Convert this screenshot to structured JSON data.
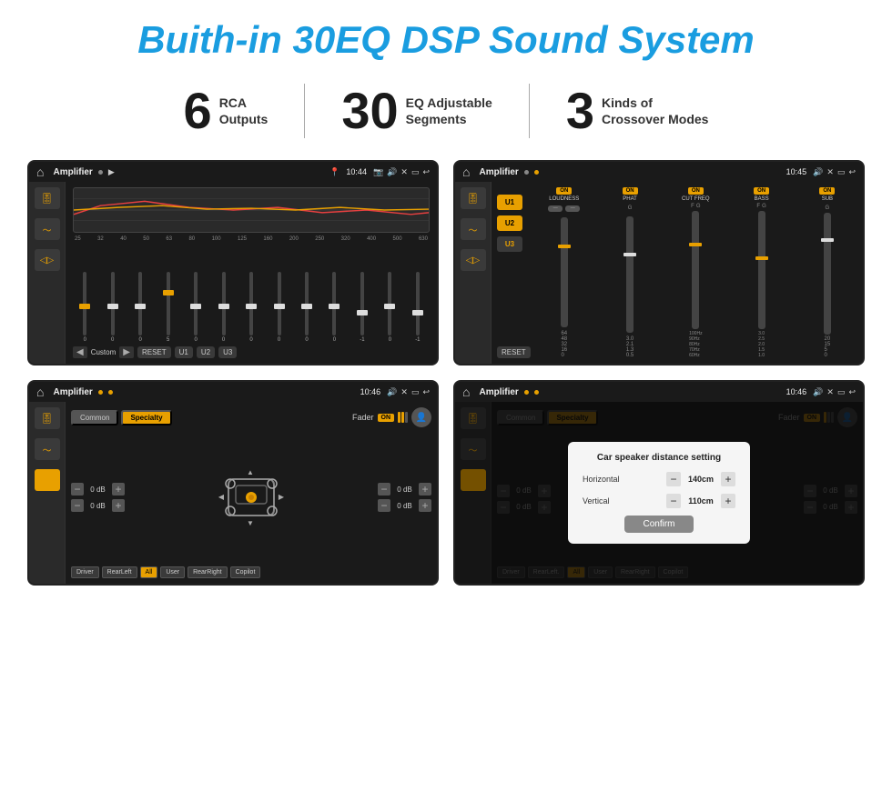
{
  "title": "Buith-in 30EQ DSP Sound System",
  "stats": [
    {
      "number": "6",
      "label": "RCA\nOutputs"
    },
    {
      "number": "30",
      "label": "EQ Adjustable\nSegments"
    },
    {
      "number": "3",
      "label": "Kinds of\nCrossover Modes"
    }
  ],
  "screens": [
    {
      "id": "eq-screen",
      "status_title": "Amplifier",
      "status_time": "10:44",
      "type": "equalizer",
      "freq_labels": [
        "25",
        "32",
        "40",
        "50",
        "63",
        "80",
        "100",
        "125",
        "160",
        "200",
        "250",
        "320",
        "400",
        "500",
        "630"
      ],
      "slider_values": [
        "0",
        "0",
        "0",
        "5",
        "0",
        "0",
        "0",
        "0",
        "0",
        "0",
        "-1",
        "0",
        "-1"
      ],
      "bottom_buttons": [
        "Custom",
        "RESET",
        "U1",
        "U2",
        "U3"
      ]
    },
    {
      "id": "crossover-screen",
      "status_title": "Amplifier",
      "status_time": "10:45",
      "type": "crossover",
      "presets": [
        "U1",
        "U2",
        "U3"
      ],
      "columns": [
        {
          "label": "LOUDNESS",
          "on": true
        },
        {
          "label": "PHAT",
          "on": true
        },
        {
          "label": "CUT FREQ",
          "on": true
        },
        {
          "label": "BASS",
          "on": true
        },
        {
          "label": "SUB",
          "on": true
        }
      ],
      "reset_btn": "RESET"
    },
    {
      "id": "fader-screen",
      "status_title": "Amplifier",
      "status_time": "10:46",
      "type": "fader",
      "tabs": [
        "Common",
        "Specialty"
      ],
      "active_tab": "Specialty",
      "fader_label": "Fader",
      "fader_on": "ON",
      "db_values": [
        "0 dB",
        "0 dB",
        "0 dB",
        "0 dB"
      ],
      "position_buttons": [
        "Driver",
        "RearLeft",
        "All",
        "User",
        "RearRight",
        "Copilot"
      ]
    },
    {
      "id": "distance-screen",
      "status_title": "Amplifier",
      "status_time": "10:46",
      "type": "distance",
      "tabs": [
        "Common",
        "Specialty"
      ],
      "dialog": {
        "title": "Car speaker distance setting",
        "horizontal_label": "Horizontal",
        "horizontal_value": "140cm",
        "vertical_label": "Vertical",
        "vertical_value": "110cm",
        "confirm_btn": "Confirm"
      },
      "db_values": [
        "0 dB",
        "0 dB"
      ],
      "position_buttons": [
        "Driver",
        "RearLeft.",
        "All",
        "User",
        "RearRight",
        "Copilot"
      ]
    }
  ]
}
